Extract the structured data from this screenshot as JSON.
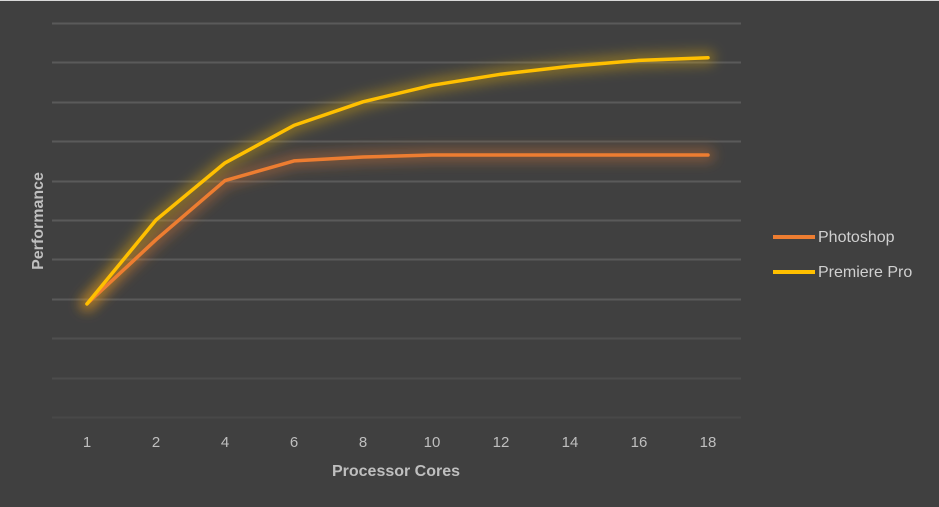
{
  "chart_data": {
    "type": "line",
    "title": "",
    "xlabel": "Processor Cores",
    "ylabel": "Performance",
    "categories": [
      "1",
      "2",
      "4",
      "6",
      "8",
      "10",
      "12",
      "14",
      "16",
      "18"
    ],
    "ylim": [
      0,
      10
    ],
    "y_gridlines": 10,
    "y_tick_labels_visible": false,
    "grid": true,
    "legend_position": "right",
    "series": [
      {
        "name": "Photoshop",
        "color": "#ed7d31",
        "values": [
          2.87,
          4.5,
          6.0,
          6.5,
          6.6,
          6.65,
          6.65,
          6.65,
          6.65,
          6.65
        ]
      },
      {
        "name": "Premiere Pro",
        "color": "#ffc000",
        "values": [
          2.87,
          5.0,
          6.45,
          7.4,
          8.0,
          8.42,
          8.7,
          8.9,
          9.05,
          9.12
        ]
      }
    ]
  }
}
